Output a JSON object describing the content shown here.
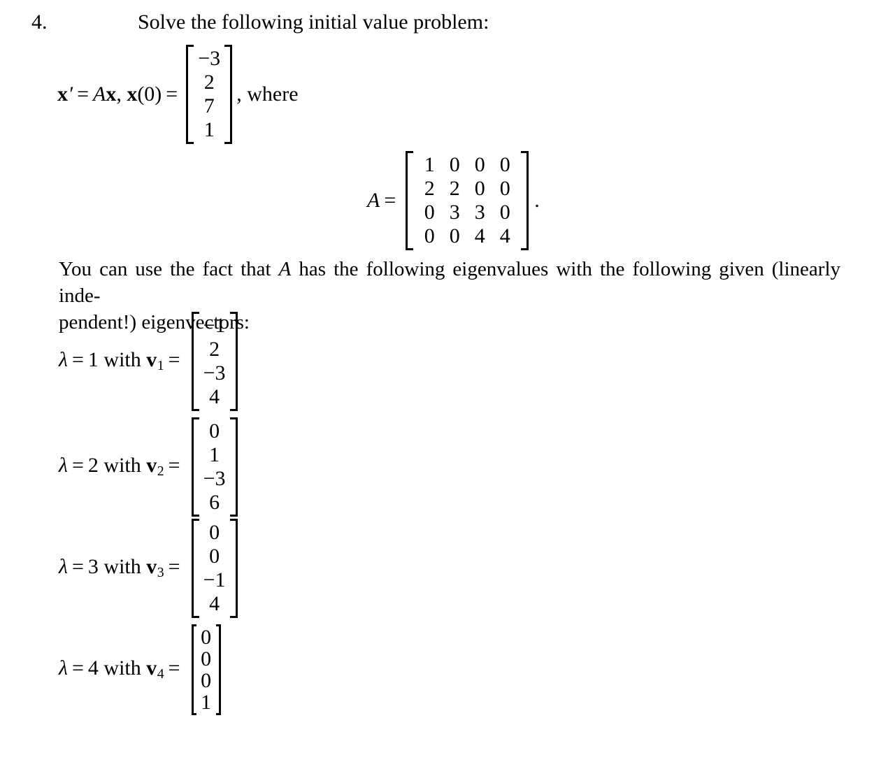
{
  "problem": {
    "number": "4.",
    "prompt": "Solve the following initial value problem:"
  },
  "initial_value_equation": {
    "lead": "x′ = Ax, x(0) =",
    "lead_parts": {
      "x": "x",
      "prime": "′",
      "equals": "=",
      "A": "A",
      "x2": "x",
      "comma": ",",
      "x3": "x",
      "zero_arg": "(0)",
      "equals2": "="
    },
    "vector": [
      "−3",
      "2",
      "7",
      "1"
    ],
    "trail": ", where"
  },
  "matrix_A": {
    "label": "A",
    "equals": "=",
    "rows": [
      [
        "1",
        "0",
        "0",
        "0"
      ],
      [
        "2",
        "2",
        "0",
        "0"
      ],
      [
        "0",
        "3",
        "3",
        "0"
      ],
      [
        "0",
        "0",
        "4",
        "4"
      ]
    ],
    "trail": "."
  },
  "fact_paragraph": {
    "line1": "You can use the fact that A has the following eigenvalues with the following given (linearly inde-",
    "line2": "pendent!) eigenvectors:",
    "segments": {
      "before_A": "You can use the fact that ",
      "A": "A",
      "after_A": " has the following eigenvalues with the following given (linearly inde-"
    }
  },
  "eigenpairs": [
    {
      "label": "λ = 1 with v₁ =",
      "lambda": "λ",
      "equals": "=",
      "value": "1",
      "with": "with",
      "vector_symbol": "v",
      "vector_index": "1",
      "equals2": "=",
      "vector": [
        "−1",
        "2",
        "−3",
        "4"
      ],
      "narrow": false
    },
    {
      "label": "λ = 2 with v₂ =",
      "lambda": "λ",
      "equals": "=",
      "value": "2",
      "with": "with",
      "vector_symbol": "v",
      "vector_index": "2",
      "equals2": "=",
      "vector": [
        "0",
        "1",
        "−3",
        "6"
      ],
      "narrow": false
    },
    {
      "label": "λ = 3 with v₃ =",
      "lambda": "λ",
      "equals": "=",
      "value": "3",
      "with": "with",
      "vector_symbol": "v",
      "vector_index": "3",
      "equals2": "=",
      "vector": [
        "0",
        "0",
        "−1",
        "4"
      ],
      "narrow": false
    },
    {
      "label": "λ = 4 with v₄ =",
      "lambda": "λ",
      "equals": "=",
      "value": "4",
      "with": "with",
      "vector_symbol": "v",
      "vector_index": "4",
      "equals2": "=",
      "vector": [
        "0",
        "0",
        "0",
        "1"
      ],
      "narrow": true
    }
  ],
  "colors": {
    "page_background": "#ffffff",
    "ink": "#000000"
  }
}
